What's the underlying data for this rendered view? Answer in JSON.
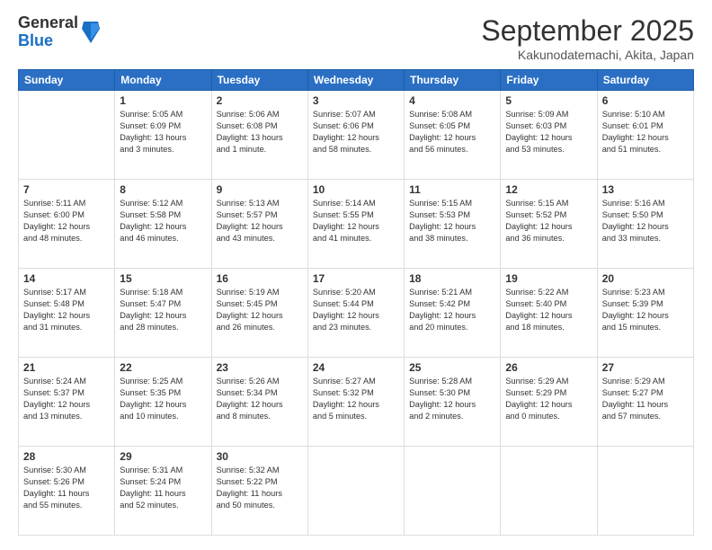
{
  "header": {
    "logo_general": "General",
    "logo_blue": "Blue",
    "month_title": "September 2025",
    "location": "Kakunodatemachi, Akita, Japan"
  },
  "weekdays": [
    "Sunday",
    "Monday",
    "Tuesday",
    "Wednesday",
    "Thursday",
    "Friday",
    "Saturday"
  ],
  "weeks": [
    [
      {
        "day": "",
        "info": ""
      },
      {
        "day": "1",
        "info": "Sunrise: 5:05 AM\nSunset: 6:09 PM\nDaylight: 13 hours\nand 3 minutes."
      },
      {
        "day": "2",
        "info": "Sunrise: 5:06 AM\nSunset: 6:08 PM\nDaylight: 13 hours\nand 1 minute."
      },
      {
        "day": "3",
        "info": "Sunrise: 5:07 AM\nSunset: 6:06 PM\nDaylight: 12 hours\nand 58 minutes."
      },
      {
        "day": "4",
        "info": "Sunrise: 5:08 AM\nSunset: 6:05 PM\nDaylight: 12 hours\nand 56 minutes."
      },
      {
        "day": "5",
        "info": "Sunrise: 5:09 AM\nSunset: 6:03 PM\nDaylight: 12 hours\nand 53 minutes."
      },
      {
        "day": "6",
        "info": "Sunrise: 5:10 AM\nSunset: 6:01 PM\nDaylight: 12 hours\nand 51 minutes."
      }
    ],
    [
      {
        "day": "7",
        "info": "Sunrise: 5:11 AM\nSunset: 6:00 PM\nDaylight: 12 hours\nand 48 minutes."
      },
      {
        "day": "8",
        "info": "Sunrise: 5:12 AM\nSunset: 5:58 PM\nDaylight: 12 hours\nand 46 minutes."
      },
      {
        "day": "9",
        "info": "Sunrise: 5:13 AM\nSunset: 5:57 PM\nDaylight: 12 hours\nand 43 minutes."
      },
      {
        "day": "10",
        "info": "Sunrise: 5:14 AM\nSunset: 5:55 PM\nDaylight: 12 hours\nand 41 minutes."
      },
      {
        "day": "11",
        "info": "Sunrise: 5:15 AM\nSunset: 5:53 PM\nDaylight: 12 hours\nand 38 minutes."
      },
      {
        "day": "12",
        "info": "Sunrise: 5:15 AM\nSunset: 5:52 PM\nDaylight: 12 hours\nand 36 minutes."
      },
      {
        "day": "13",
        "info": "Sunrise: 5:16 AM\nSunset: 5:50 PM\nDaylight: 12 hours\nand 33 minutes."
      }
    ],
    [
      {
        "day": "14",
        "info": "Sunrise: 5:17 AM\nSunset: 5:48 PM\nDaylight: 12 hours\nand 31 minutes."
      },
      {
        "day": "15",
        "info": "Sunrise: 5:18 AM\nSunset: 5:47 PM\nDaylight: 12 hours\nand 28 minutes."
      },
      {
        "day": "16",
        "info": "Sunrise: 5:19 AM\nSunset: 5:45 PM\nDaylight: 12 hours\nand 26 minutes."
      },
      {
        "day": "17",
        "info": "Sunrise: 5:20 AM\nSunset: 5:44 PM\nDaylight: 12 hours\nand 23 minutes."
      },
      {
        "day": "18",
        "info": "Sunrise: 5:21 AM\nSunset: 5:42 PM\nDaylight: 12 hours\nand 20 minutes."
      },
      {
        "day": "19",
        "info": "Sunrise: 5:22 AM\nSunset: 5:40 PM\nDaylight: 12 hours\nand 18 minutes."
      },
      {
        "day": "20",
        "info": "Sunrise: 5:23 AM\nSunset: 5:39 PM\nDaylight: 12 hours\nand 15 minutes."
      }
    ],
    [
      {
        "day": "21",
        "info": "Sunrise: 5:24 AM\nSunset: 5:37 PM\nDaylight: 12 hours\nand 13 minutes."
      },
      {
        "day": "22",
        "info": "Sunrise: 5:25 AM\nSunset: 5:35 PM\nDaylight: 12 hours\nand 10 minutes."
      },
      {
        "day": "23",
        "info": "Sunrise: 5:26 AM\nSunset: 5:34 PM\nDaylight: 12 hours\nand 8 minutes."
      },
      {
        "day": "24",
        "info": "Sunrise: 5:27 AM\nSunset: 5:32 PM\nDaylight: 12 hours\nand 5 minutes."
      },
      {
        "day": "25",
        "info": "Sunrise: 5:28 AM\nSunset: 5:30 PM\nDaylight: 12 hours\nand 2 minutes."
      },
      {
        "day": "26",
        "info": "Sunrise: 5:29 AM\nSunset: 5:29 PM\nDaylight: 12 hours\nand 0 minutes."
      },
      {
        "day": "27",
        "info": "Sunrise: 5:29 AM\nSunset: 5:27 PM\nDaylight: 11 hours\nand 57 minutes."
      }
    ],
    [
      {
        "day": "28",
        "info": "Sunrise: 5:30 AM\nSunset: 5:26 PM\nDaylight: 11 hours\nand 55 minutes."
      },
      {
        "day": "29",
        "info": "Sunrise: 5:31 AM\nSunset: 5:24 PM\nDaylight: 11 hours\nand 52 minutes."
      },
      {
        "day": "30",
        "info": "Sunrise: 5:32 AM\nSunset: 5:22 PM\nDaylight: 11 hours\nand 50 minutes."
      },
      {
        "day": "",
        "info": ""
      },
      {
        "day": "",
        "info": ""
      },
      {
        "day": "",
        "info": ""
      },
      {
        "day": "",
        "info": ""
      }
    ]
  ]
}
